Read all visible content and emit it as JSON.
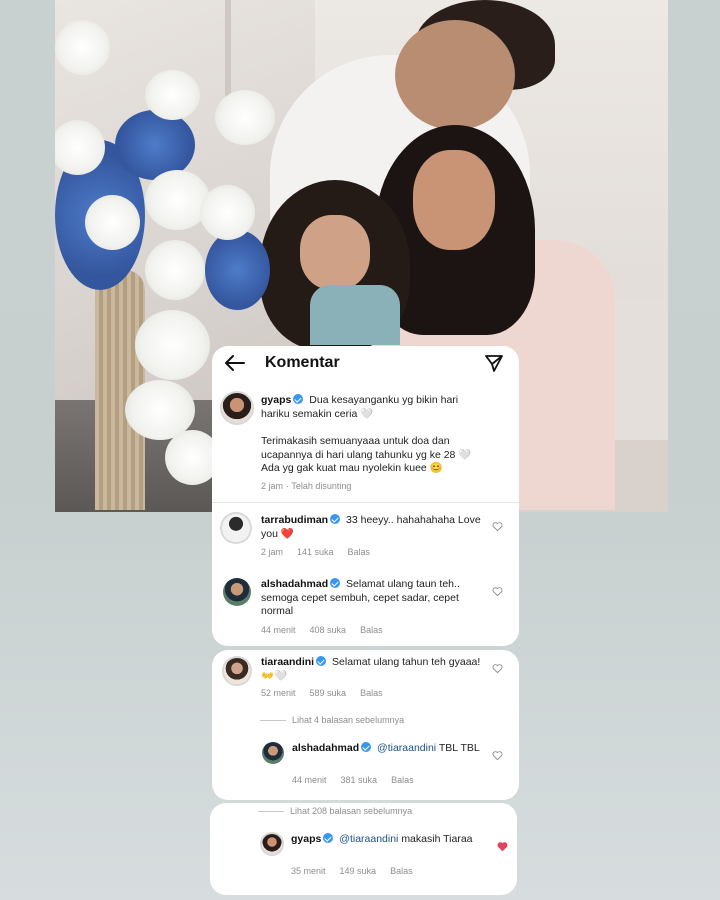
{
  "header": {
    "title": "Komentar"
  },
  "caption": {
    "username": "gyaps",
    "text1": "Dua kesayanganku yg bikin hari hariku semakin ceria 🤍",
    "text2": "Terimakasih semuanyaaa untuk doa dan ucapannya di hari ulang tahunku yg ke 28 🤍 Ada yg gak kuat mau nyolekin kuee 😊",
    "time": "2 jam",
    "edited": "· Telah disunting"
  },
  "comments": [
    {
      "username": "tarrabudiman",
      "text": "33 heeyy.. hahahahaha Love you ❤️",
      "time": "2 jam",
      "likes": "141 suka",
      "reply": "Balas"
    },
    {
      "username": "alshadahmad",
      "text": "Selamat ulang taun teh.. semoga cepet sembuh, cepet sadar, cepet normal",
      "time": "44 menit",
      "likes": "408 suka",
      "reply": "Balas"
    },
    {
      "username": "tiaraandini",
      "text": "Selamat ulang tahun teh gyaaa! 👐🤍",
      "time": "52 menit",
      "likes": "589 suka",
      "reply": "Balas"
    }
  ],
  "replies": [
    {
      "more_label": "Lihat 4 balasan sebelumnya",
      "username": "alshadahmad",
      "mention": "@tiaraandini",
      "text": "TBL TBL",
      "time": "44 menit",
      "likes": "381 suka",
      "reply": "Balas"
    },
    {
      "more_label": "Lihat 208 balasan sebelumnya",
      "username": "gyaps",
      "mention": "@tiaraandini",
      "text": "makasih Tiaraa",
      "time": "35 menit",
      "likes": "149 suka",
      "reply": "Balas"
    }
  ],
  "colors": {
    "verified": "#3897f0",
    "liked_heart": "#e0445c",
    "meta": "#8e8e8e"
  },
  "icons": {
    "back": "back-arrow-icon",
    "send": "send-icon",
    "like": "heart-icon",
    "verified": "verified-badge-icon"
  }
}
